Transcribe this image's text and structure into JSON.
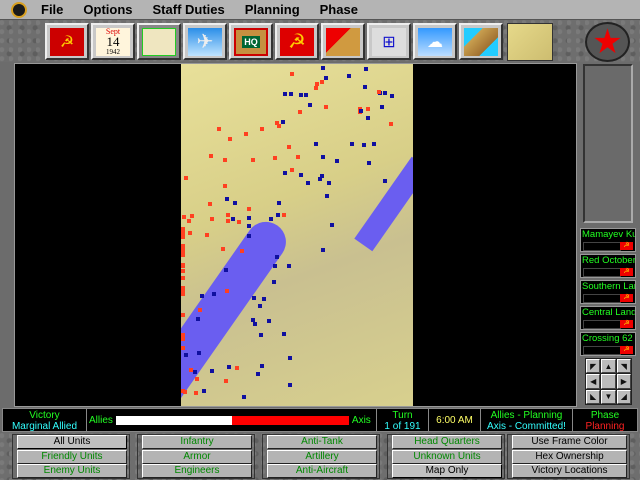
{
  "menu": [
    "File",
    "Options",
    "Staff Duties",
    "Planning",
    "Phase"
  ],
  "toolbar": {
    "items": [
      {
        "name": "soviet-flag-icon",
        "glyph": "☭"
      },
      {
        "name": "calendar-icon",
        "month": "Sept",
        "day": "14",
        "year": "1942"
      },
      {
        "name": "tactical-map-icon",
        "glyph": ""
      },
      {
        "name": "aircraft-icon",
        "glyph": "✈"
      },
      {
        "name": "hq-icon",
        "label": "HQ"
      },
      {
        "name": "hammer-sickle-icon",
        "glyph": "☭"
      },
      {
        "name": "reports-icon",
        "glyph": ""
      },
      {
        "name": "org-chart-icon",
        "glyph": "⊞"
      },
      {
        "name": "weather-icon",
        "glyph": "☁"
      },
      {
        "name": "strategic-map-icon",
        "glyph": ""
      }
    ]
  },
  "victory_locations": [
    {
      "name": "Mamayev Kurgan"
    },
    {
      "name": "Red October"
    },
    {
      "name": "Southern Landing"
    },
    {
      "name": "Central Landing"
    },
    {
      "name": "Crossing 62"
    }
  ],
  "status": {
    "victory_label": "Victory",
    "victory_value": "Marginal Allied",
    "allies": "Allies",
    "axis": "Axis",
    "allies_fraction": 0.5,
    "turn_label": "Turn",
    "turn_value": "1 of 191",
    "time": "6:00 AM",
    "allies_state": "Allies - Planning",
    "axis_state": "Axis - Committed!",
    "phase_label": "Phase",
    "phase_value": "Planning"
  },
  "buttons": {
    "units": [
      "All Units",
      "Friendly Units",
      "Enemy Units"
    ],
    "types1": [
      "Infantry",
      "Armor",
      "Engineers"
    ],
    "types2": [
      "Anti-Tank",
      "Artillery",
      "Anti-Aircraft"
    ],
    "types3": [
      "Head Quarters",
      "Unknown Units",
      "Map Only"
    ],
    "display": [
      "Use Frame Color",
      "Hex Ownership",
      "Victory Locations"
    ]
  },
  "colors": {
    "allied": "#ff4020",
    "axis": "#1010a0",
    "river": "#6a5ef0"
  }
}
